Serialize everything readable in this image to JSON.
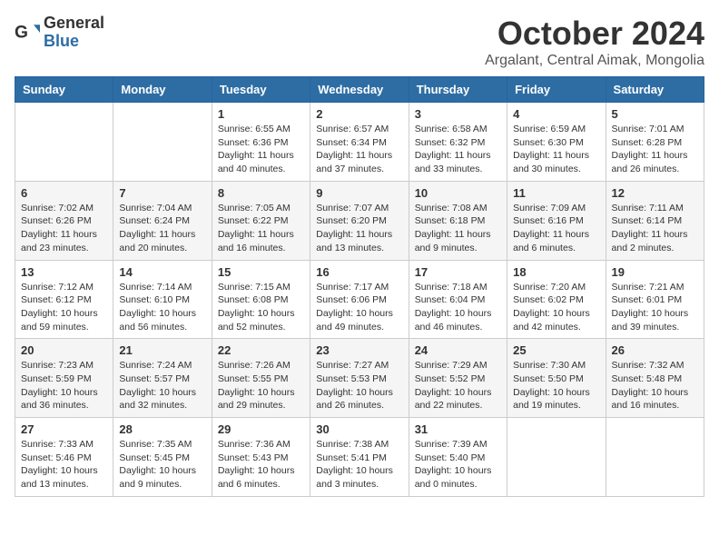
{
  "logo": {
    "general": "General",
    "blue": "Blue"
  },
  "header": {
    "month_title": "October 2024",
    "location": "Argalant, Central Aimak, Mongolia"
  },
  "days_of_week": [
    "Sunday",
    "Monday",
    "Tuesday",
    "Wednesday",
    "Thursday",
    "Friday",
    "Saturday"
  ],
  "weeks": [
    [
      {
        "day": "",
        "info": ""
      },
      {
        "day": "",
        "info": ""
      },
      {
        "day": "1",
        "info": "Sunrise: 6:55 AM\nSunset: 6:36 PM\nDaylight: 11 hours and 40 minutes."
      },
      {
        "day": "2",
        "info": "Sunrise: 6:57 AM\nSunset: 6:34 PM\nDaylight: 11 hours and 37 minutes."
      },
      {
        "day": "3",
        "info": "Sunrise: 6:58 AM\nSunset: 6:32 PM\nDaylight: 11 hours and 33 minutes."
      },
      {
        "day": "4",
        "info": "Sunrise: 6:59 AM\nSunset: 6:30 PM\nDaylight: 11 hours and 30 minutes."
      },
      {
        "day": "5",
        "info": "Sunrise: 7:01 AM\nSunset: 6:28 PM\nDaylight: 11 hours and 26 minutes."
      }
    ],
    [
      {
        "day": "6",
        "info": "Sunrise: 7:02 AM\nSunset: 6:26 PM\nDaylight: 11 hours and 23 minutes."
      },
      {
        "day": "7",
        "info": "Sunrise: 7:04 AM\nSunset: 6:24 PM\nDaylight: 11 hours and 20 minutes."
      },
      {
        "day": "8",
        "info": "Sunrise: 7:05 AM\nSunset: 6:22 PM\nDaylight: 11 hours and 16 minutes."
      },
      {
        "day": "9",
        "info": "Sunrise: 7:07 AM\nSunset: 6:20 PM\nDaylight: 11 hours and 13 minutes."
      },
      {
        "day": "10",
        "info": "Sunrise: 7:08 AM\nSunset: 6:18 PM\nDaylight: 11 hours and 9 minutes."
      },
      {
        "day": "11",
        "info": "Sunrise: 7:09 AM\nSunset: 6:16 PM\nDaylight: 11 hours and 6 minutes."
      },
      {
        "day": "12",
        "info": "Sunrise: 7:11 AM\nSunset: 6:14 PM\nDaylight: 11 hours and 2 minutes."
      }
    ],
    [
      {
        "day": "13",
        "info": "Sunrise: 7:12 AM\nSunset: 6:12 PM\nDaylight: 10 hours and 59 minutes."
      },
      {
        "day": "14",
        "info": "Sunrise: 7:14 AM\nSunset: 6:10 PM\nDaylight: 10 hours and 56 minutes."
      },
      {
        "day": "15",
        "info": "Sunrise: 7:15 AM\nSunset: 6:08 PM\nDaylight: 10 hours and 52 minutes."
      },
      {
        "day": "16",
        "info": "Sunrise: 7:17 AM\nSunset: 6:06 PM\nDaylight: 10 hours and 49 minutes."
      },
      {
        "day": "17",
        "info": "Sunrise: 7:18 AM\nSunset: 6:04 PM\nDaylight: 10 hours and 46 minutes."
      },
      {
        "day": "18",
        "info": "Sunrise: 7:20 AM\nSunset: 6:02 PM\nDaylight: 10 hours and 42 minutes."
      },
      {
        "day": "19",
        "info": "Sunrise: 7:21 AM\nSunset: 6:01 PM\nDaylight: 10 hours and 39 minutes."
      }
    ],
    [
      {
        "day": "20",
        "info": "Sunrise: 7:23 AM\nSunset: 5:59 PM\nDaylight: 10 hours and 36 minutes."
      },
      {
        "day": "21",
        "info": "Sunrise: 7:24 AM\nSunset: 5:57 PM\nDaylight: 10 hours and 32 minutes."
      },
      {
        "day": "22",
        "info": "Sunrise: 7:26 AM\nSunset: 5:55 PM\nDaylight: 10 hours and 29 minutes."
      },
      {
        "day": "23",
        "info": "Sunrise: 7:27 AM\nSunset: 5:53 PM\nDaylight: 10 hours and 26 minutes."
      },
      {
        "day": "24",
        "info": "Sunrise: 7:29 AM\nSunset: 5:52 PM\nDaylight: 10 hours and 22 minutes."
      },
      {
        "day": "25",
        "info": "Sunrise: 7:30 AM\nSunset: 5:50 PM\nDaylight: 10 hours and 19 minutes."
      },
      {
        "day": "26",
        "info": "Sunrise: 7:32 AM\nSunset: 5:48 PM\nDaylight: 10 hours and 16 minutes."
      }
    ],
    [
      {
        "day": "27",
        "info": "Sunrise: 7:33 AM\nSunset: 5:46 PM\nDaylight: 10 hours and 13 minutes."
      },
      {
        "day": "28",
        "info": "Sunrise: 7:35 AM\nSunset: 5:45 PM\nDaylight: 10 hours and 9 minutes."
      },
      {
        "day": "29",
        "info": "Sunrise: 7:36 AM\nSunset: 5:43 PM\nDaylight: 10 hours and 6 minutes."
      },
      {
        "day": "30",
        "info": "Sunrise: 7:38 AM\nSunset: 5:41 PM\nDaylight: 10 hours and 3 minutes."
      },
      {
        "day": "31",
        "info": "Sunrise: 7:39 AM\nSunset: 5:40 PM\nDaylight: 10 hours and 0 minutes."
      },
      {
        "day": "",
        "info": ""
      },
      {
        "day": "",
        "info": ""
      }
    ]
  ]
}
